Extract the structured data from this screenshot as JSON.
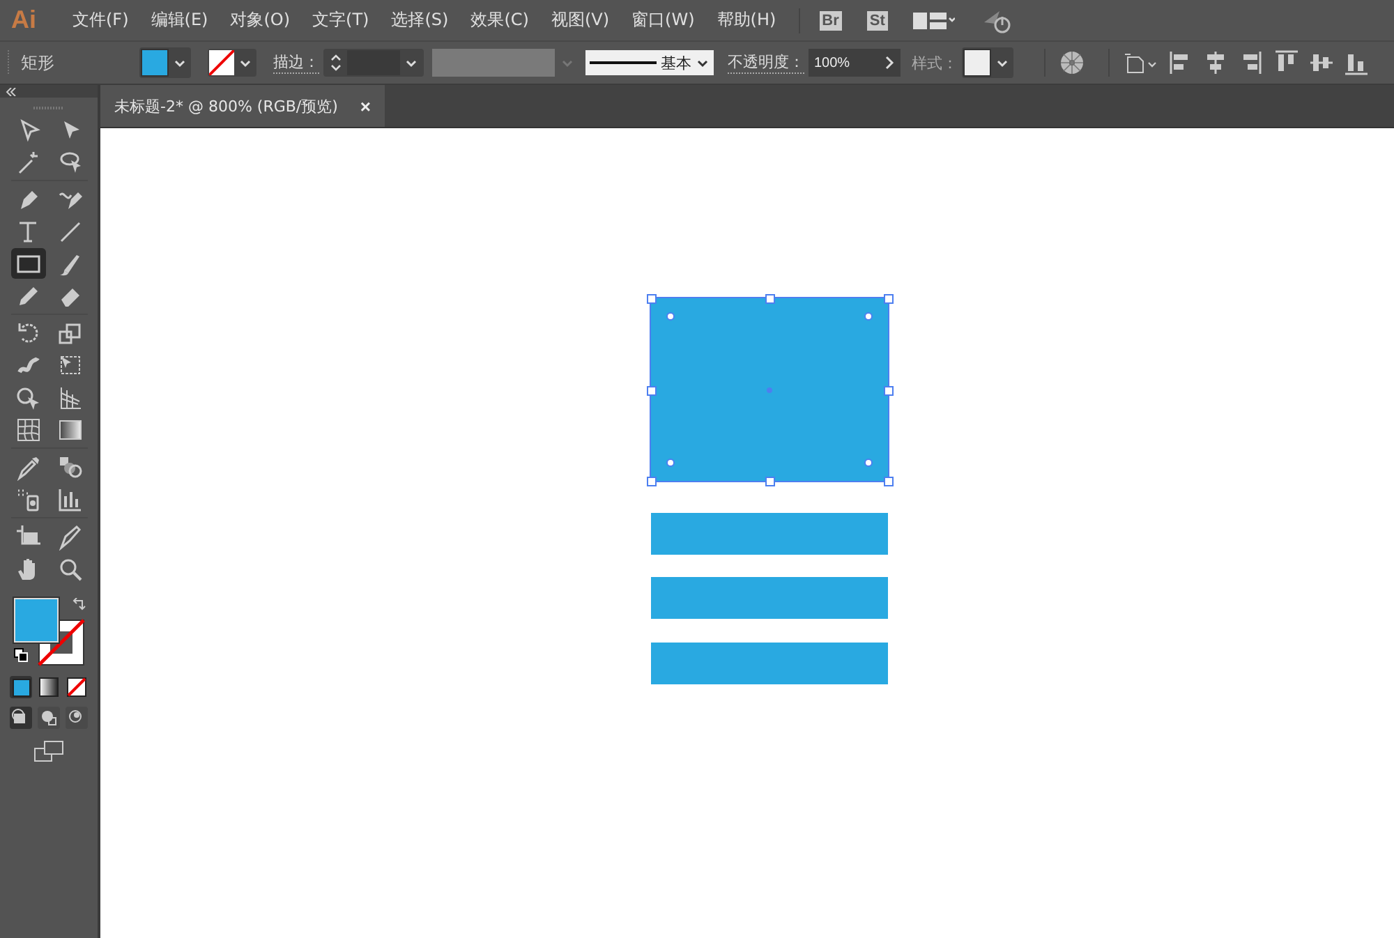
{
  "app": {
    "logo": "Ai"
  },
  "menu": [
    {
      "label": "文件(F)"
    },
    {
      "label": "编辑(E)"
    },
    {
      "label": "对象(O)"
    },
    {
      "label": "文字(T)"
    },
    {
      "label": "选择(S)"
    },
    {
      "label": "效果(C)"
    },
    {
      "label": "视图(V)"
    },
    {
      "label": "窗口(W)"
    },
    {
      "label": "帮助(H)"
    }
  ],
  "menu_apps": [
    {
      "label": "Br"
    },
    {
      "label": "St"
    }
  ],
  "control_bar": {
    "object_label": "矩形",
    "stroke_label": "描边：",
    "stroke_profile": "基本",
    "opacity_label": "不透明度：",
    "opacity_value": "100%",
    "style_label": "样式："
  },
  "document_tab": {
    "title": "未标题-2* @ 800% (RGB/预览)",
    "close": "×"
  },
  "tools": [
    {
      "kind": "select",
      "selected": false
    },
    {
      "kind": "direct",
      "selected": false
    },
    {
      "kind": "wand",
      "selected": false
    },
    {
      "kind": "lasso",
      "selected": false
    },
    {
      "kind": "pen",
      "selected": false
    },
    {
      "kind": "curvature",
      "selected": false
    },
    {
      "kind": "type",
      "selected": false
    },
    {
      "kind": "line",
      "selected": false
    },
    {
      "kind": "rect",
      "selected": true
    },
    {
      "kind": "brush",
      "selected": false
    },
    {
      "kind": "pencil",
      "selected": false
    },
    {
      "kind": "eraser",
      "selected": false
    },
    {
      "kind": "rotate",
      "selected": false
    },
    {
      "kind": "scale",
      "selected": false
    },
    {
      "kind": "warp",
      "selected": false
    },
    {
      "kind": "transform",
      "selected": false
    },
    {
      "kind": "shapebuilder",
      "selected": false
    },
    {
      "kind": "perspective",
      "selected": false
    },
    {
      "kind": "mesh",
      "selected": false
    },
    {
      "kind": "gradient",
      "selected": false
    },
    {
      "kind": "eyedropper",
      "selected": false
    },
    {
      "kind": "blend",
      "selected": false
    },
    {
      "kind": "spray",
      "selected": false
    },
    {
      "kind": "graph",
      "selected": false
    },
    {
      "kind": "artboard",
      "selected": false
    },
    {
      "kind": "slice",
      "selected": false
    },
    {
      "kind": "hand",
      "selected": false
    },
    {
      "kind": "zoom",
      "selected": false
    }
  ],
  "canvas": {
    "shapes": [
      {
        "kind": "rect",
        "color": "#29a9e1",
        "selected": true
      },
      {
        "kind": "bar",
        "color": "#29a9e1",
        "selected": false
      },
      {
        "kind": "bar",
        "color": "#29a9e1",
        "selected": false
      },
      {
        "kind": "bar",
        "color": "#29a9e1",
        "selected": false
      }
    ]
  }
}
